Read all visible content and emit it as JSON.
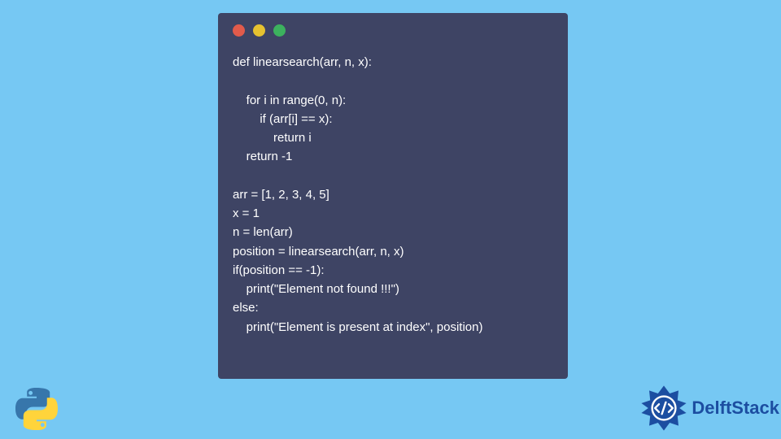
{
  "code": {
    "lines": [
      "def linearsearch(arr, n, x):",
      "",
      "    for i in range(0, n):",
      "        if (arr[i] == x):",
      "            return i",
      "    return -1",
      "",
      "arr = [1, 2, 3, 4, 5]",
      "x = 1",
      "n = len(arr)",
      "position = linearsearch(arr, n, x)",
      "if(position == -1):",
      "    print(\"Element not found !!!\")",
      "else:",
      "    print(\"Element is present at index\", position)"
    ]
  },
  "brand": {
    "name": "DelftStack"
  },
  "colors": {
    "bg": "#76c8f3",
    "window": "#3e4464",
    "red": "#e15b4b",
    "yellow": "#e6c230",
    "green": "#3cb25e",
    "brand": "#1c4ea1"
  }
}
